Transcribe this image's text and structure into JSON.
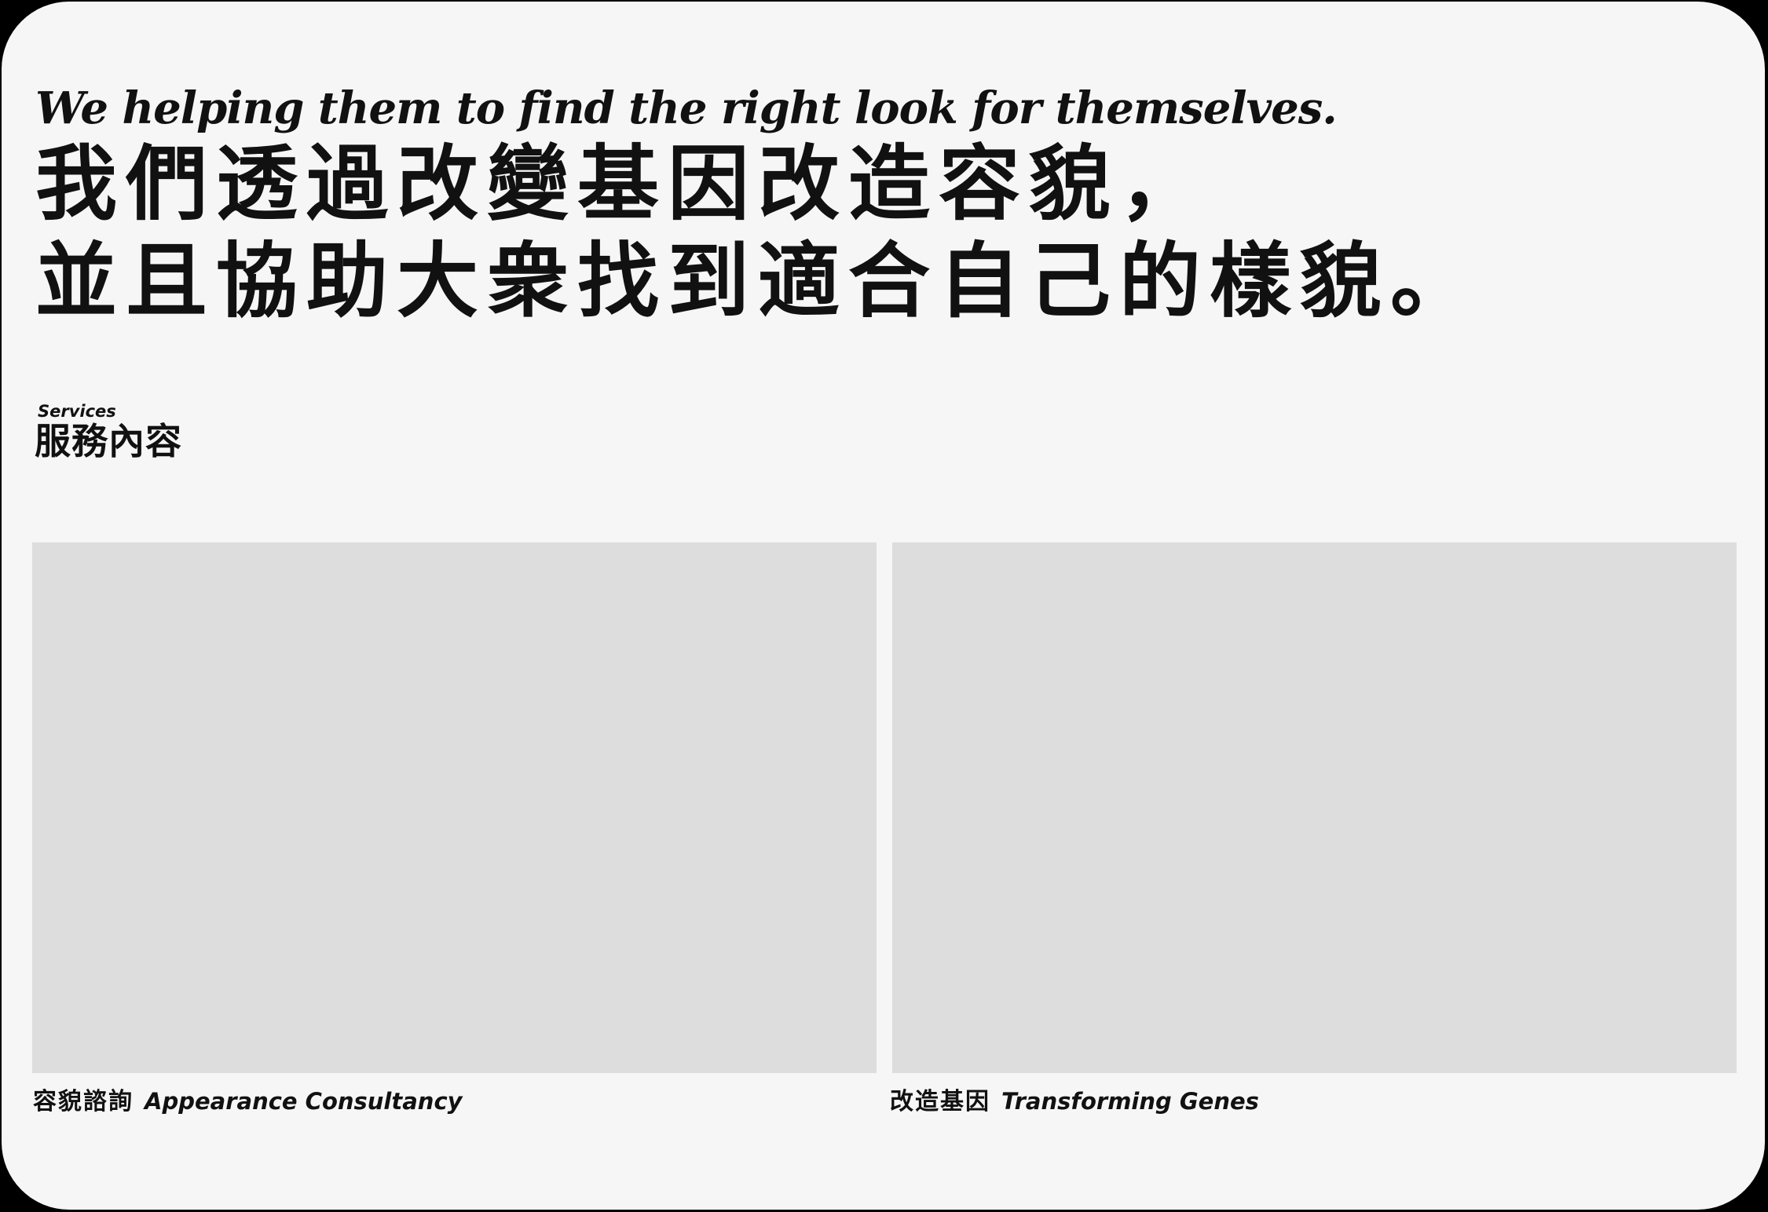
{
  "hero": {
    "tagline_en": "We helping them to find the right look for themselves.",
    "tagline_zh_line1": "我們透過改變基因改造容貌，",
    "tagline_zh_line2": "並且協助大衆找到適合自己的樣貌。"
  },
  "services": {
    "label_en": "Services",
    "label_zh": "服務內容",
    "items": [
      {
        "title_zh": "容貌諮詢",
        "title_en": "Appearance Consultancy"
      },
      {
        "title_zh": "改造基因",
        "title_en": "Transforming Genes"
      }
    ]
  },
  "colors": {
    "background": "#f5f6f5",
    "frame": "#000000",
    "placeholder": "#dcdddc",
    "text": "#111111"
  }
}
